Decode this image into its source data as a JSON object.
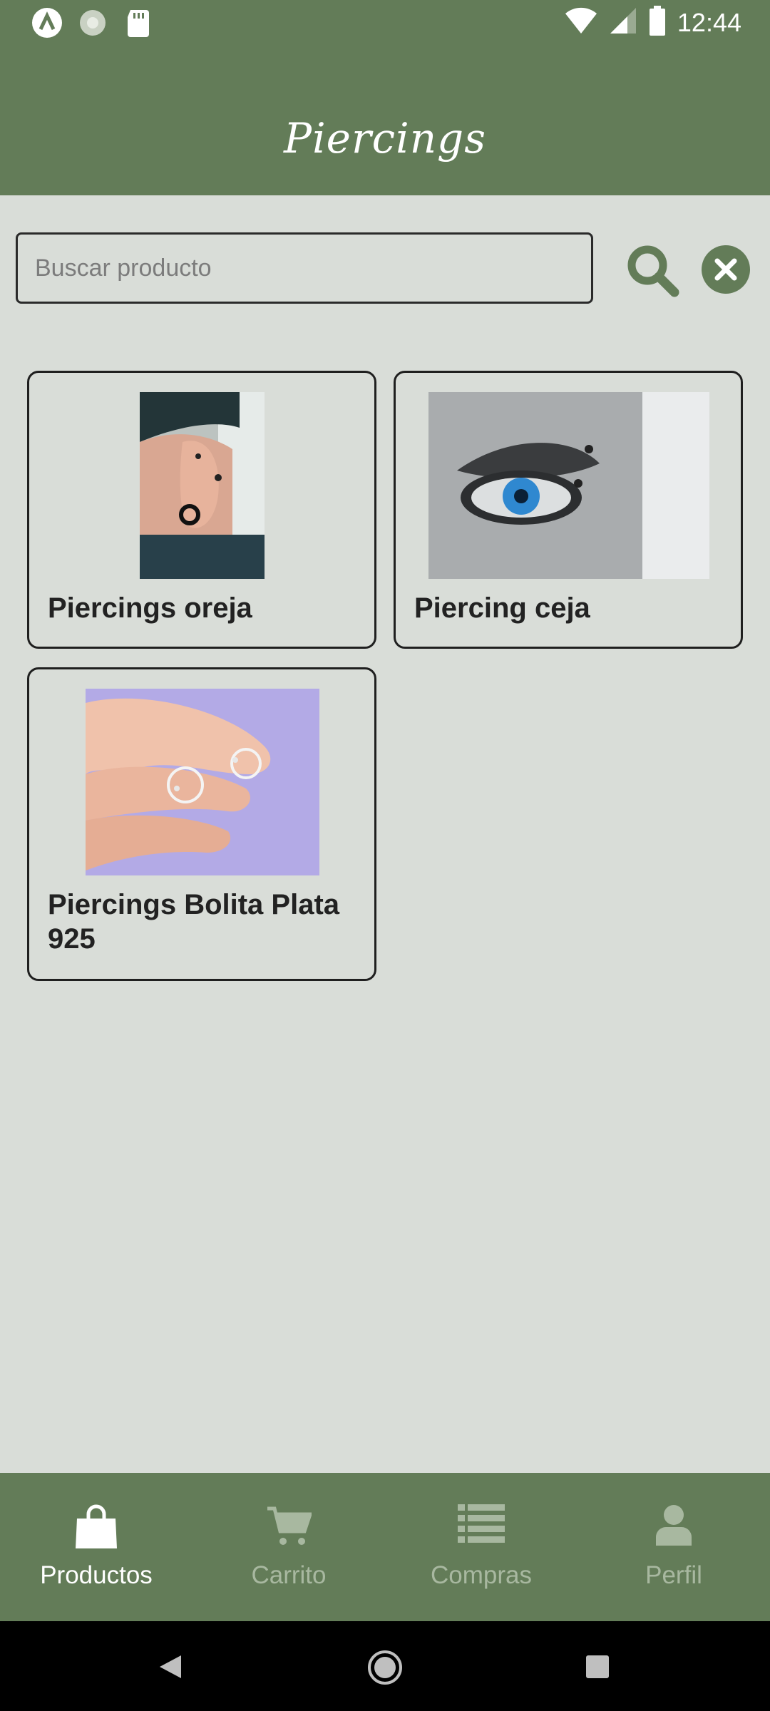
{
  "status_bar": {
    "time": "12:44",
    "icons": [
      "app-a-icon",
      "sun-icon",
      "sdcard-icon",
      "wifi-icon",
      "signal-icon",
      "battery-icon"
    ]
  },
  "app_bar": {
    "title": "Piercings"
  },
  "search": {
    "placeholder": "Buscar producto",
    "value": ""
  },
  "products": [
    {
      "name": "Piercings oreja"
    },
    {
      "name": "Piercing ceja"
    },
    {
      "name": "Piercings Bolita Plata 925"
    }
  ],
  "bottom_nav": {
    "items": [
      {
        "label": "Productos",
        "icon": "shopping-bag-icon",
        "active": true
      },
      {
        "label": "Carrito",
        "icon": "cart-icon",
        "active": false
      },
      {
        "label": "Compras",
        "icon": "list-icon",
        "active": false
      },
      {
        "label": "Perfil",
        "icon": "person-icon",
        "active": false
      }
    ]
  },
  "colors": {
    "primary": "#637c58",
    "background": "#d9ddd8",
    "inactive_nav": "#a8b8a0"
  }
}
